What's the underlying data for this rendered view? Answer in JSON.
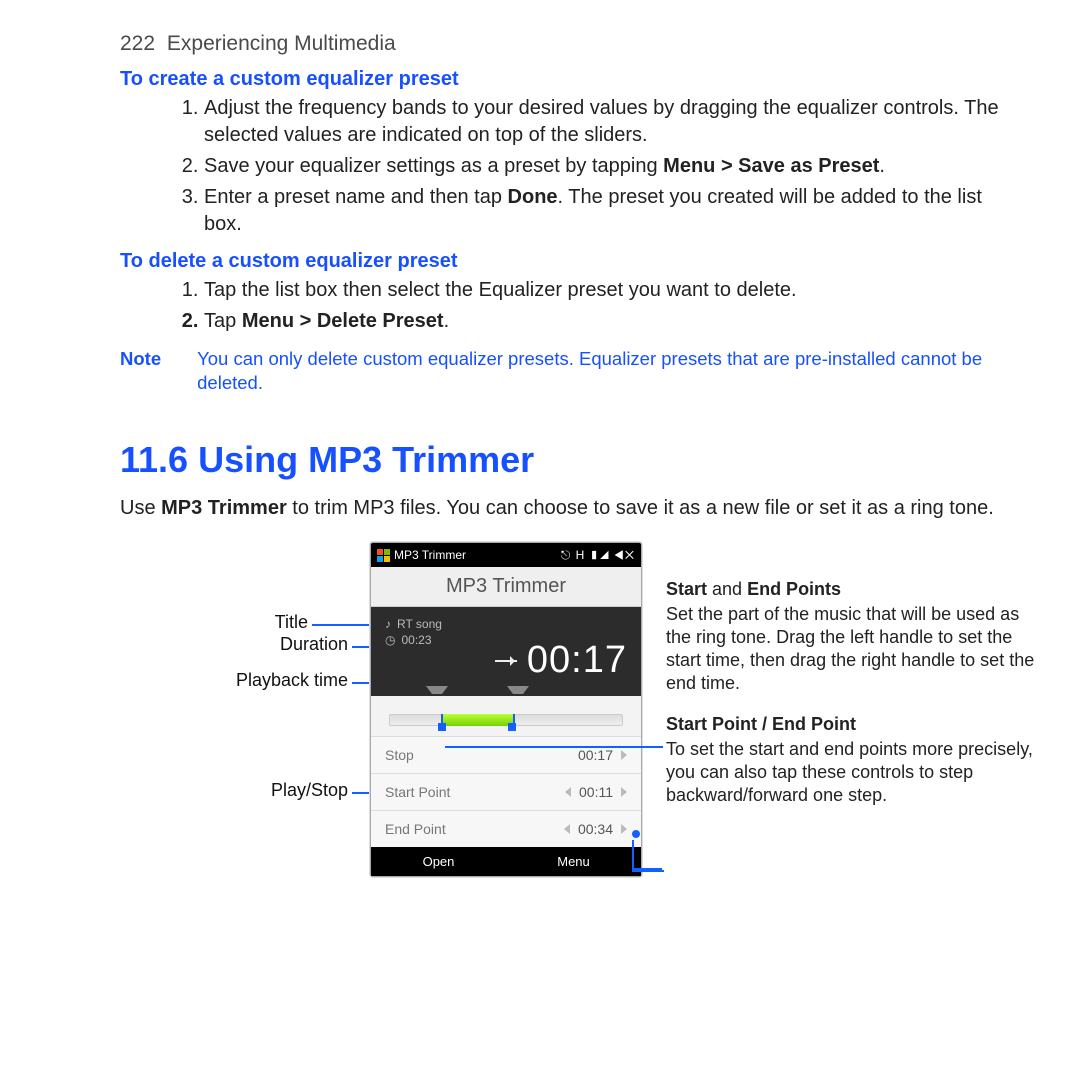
{
  "page": {
    "number": "222",
    "chapter": "Experiencing Multimedia"
  },
  "sec1": {
    "h": "To create a custom equalizer preset",
    "i1a": "Adjust the frequency bands to your desired values by dragging the equalizer controls. The selected values are indicated on top of the sliders.",
    "i2a": "Save your equalizer settings as a preset by tapping ",
    "i2b": "Menu > Save as Preset",
    "i2c": ".",
    "i3a": "Enter a preset name and then tap ",
    "i3b": "Done",
    "i3c": ". The preset you created will be added to the list box."
  },
  "sec2": {
    "h": "To delete a custom equalizer preset",
    "i1": "Tap the list box then select the Equalizer preset you want to delete.",
    "i2a": "Tap ",
    "i2b": "Menu > Delete Preset",
    "i2c": "."
  },
  "note": {
    "label": "Note",
    "text": "You can only delete custom equalizer presets. Equalizer presets that are pre-installed cannot be deleted."
  },
  "h2": "11.6  Using MP3 Trimmer",
  "intro": {
    "a": "Use ",
    "b": "MP3 Trimmer",
    "c": " to trim MP3 files. You can choose to save it as a new file or set it as a ring tone."
  },
  "phone": {
    "status_app": "MP3 Trimmer",
    "status_icons": "⎋ H ▮◢ ◀✕",
    "apptitle": "MP3 Trimmer",
    "song": "RT  song",
    "duration": "00:23",
    "playback": "00:17",
    "row_stop": "Stop",
    "row_stop_v": "00:17",
    "row_sp": "Start Point",
    "row_sp_v": "00:11",
    "row_ep": "End Point",
    "row_ep_v": "00:34",
    "sk_open": "Open",
    "sk_menu": "Menu"
  },
  "left_labels": {
    "title": "Title",
    "duration": "Duration",
    "playback": "Playback time",
    "playstop": "Play/Stop"
  },
  "right": {
    "h1a": "Start",
    "h1b": " and ",
    "h1c": "End Points",
    "p1": "Set the part of the music that will be used as the ring tone. Drag the left handle to set the start time, then drag the right handle to set the end time.",
    "h2": "Start Point / End Point",
    "p2": "To set the start and end points more precisely, you can also tap these controls to step backward/forward one step."
  }
}
